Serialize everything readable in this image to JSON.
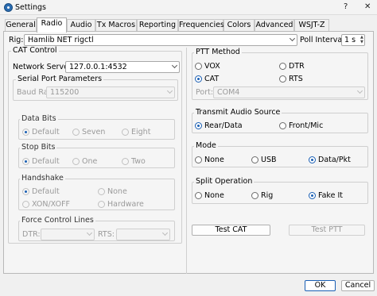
{
  "window": {
    "title": "Settings",
    "help_label": "?",
    "close_label": "✕"
  },
  "tabs": [
    {
      "label": "General"
    },
    {
      "label": "Radio",
      "active": true
    },
    {
      "label": "Audio"
    },
    {
      "label": "Tx Macros"
    },
    {
      "label": "Reporting"
    },
    {
      "label": "Frequencies"
    },
    {
      "label": "Colors"
    },
    {
      "label": "Advanced"
    },
    {
      "label": "WSJT-Z"
    }
  ],
  "rig": {
    "label": "Rig:",
    "value": "Hamlib NET rigctl",
    "poll_label": "Poll Interval:",
    "poll_value": "1 s"
  },
  "cat": {
    "title": "CAT Control",
    "network_label": "Network Server:",
    "network_value": "127.0.0.1:4532",
    "serial": {
      "title": "Serial Port Parameters",
      "baud_label": "Baud Rate:",
      "baud_value": "115200"
    },
    "data_bits": {
      "title": "Data Bits",
      "options": [
        "Default",
        "Seven",
        "Eight"
      ]
    },
    "stop_bits": {
      "title": "Stop Bits",
      "options": [
        "Default",
        "One",
        "Two"
      ]
    },
    "handshake": {
      "title": "Handshake",
      "options": [
        "Default",
        "None",
        "XON/XOFF",
        "Hardware"
      ]
    },
    "force": {
      "title": "Force Control Lines",
      "dtr_label": "DTR:",
      "rts_label": "RTS:"
    }
  },
  "ptt": {
    "title": "PTT Method",
    "options": [
      "VOX",
      "DTR",
      "CAT",
      "RTS"
    ],
    "selected": "CAT",
    "port_label": "Port:",
    "port_value": "COM4"
  },
  "audio_source": {
    "title": "Transmit Audio Source",
    "options": [
      "Rear/Data",
      "Front/Mic"
    ],
    "selected": "Rear/Data"
  },
  "mode": {
    "title": "Mode",
    "options": [
      "None",
      "USB",
      "Data/Pkt"
    ],
    "selected": "Data/Pkt"
  },
  "split": {
    "title": "Split Operation",
    "options": [
      "None",
      "Rig",
      "Fake It"
    ],
    "selected": "Fake It"
  },
  "buttons": {
    "test_cat": "Test CAT",
    "test_ptt": "Test PTT",
    "ok": "OK",
    "cancel": "Cancel"
  },
  "colors": {
    "accent": "#1a5fb4"
  }
}
